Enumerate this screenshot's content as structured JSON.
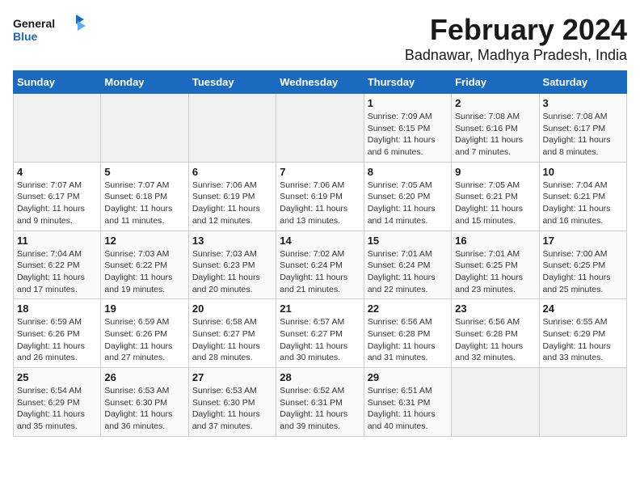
{
  "logo": {
    "line1": "General",
    "line2": "Blue"
  },
  "title": "February 2024",
  "subtitle": "Badnawar, Madhya Pradesh, India",
  "days_of_week": [
    "Sunday",
    "Monday",
    "Tuesday",
    "Wednesday",
    "Thursday",
    "Friday",
    "Saturday"
  ],
  "weeks": [
    [
      {
        "day": "",
        "info": ""
      },
      {
        "day": "",
        "info": ""
      },
      {
        "day": "",
        "info": ""
      },
      {
        "day": "",
        "info": ""
      },
      {
        "day": "1",
        "info": "Sunrise: 7:09 AM\nSunset: 6:15 PM\nDaylight: 11 hours\nand 6 minutes."
      },
      {
        "day": "2",
        "info": "Sunrise: 7:08 AM\nSunset: 6:16 PM\nDaylight: 11 hours\nand 7 minutes."
      },
      {
        "day": "3",
        "info": "Sunrise: 7:08 AM\nSunset: 6:17 PM\nDaylight: 11 hours\nand 8 minutes."
      }
    ],
    [
      {
        "day": "4",
        "info": "Sunrise: 7:07 AM\nSunset: 6:17 PM\nDaylight: 11 hours\nand 9 minutes."
      },
      {
        "day": "5",
        "info": "Sunrise: 7:07 AM\nSunset: 6:18 PM\nDaylight: 11 hours\nand 11 minutes."
      },
      {
        "day": "6",
        "info": "Sunrise: 7:06 AM\nSunset: 6:19 PM\nDaylight: 11 hours\nand 12 minutes."
      },
      {
        "day": "7",
        "info": "Sunrise: 7:06 AM\nSunset: 6:19 PM\nDaylight: 11 hours\nand 13 minutes."
      },
      {
        "day": "8",
        "info": "Sunrise: 7:05 AM\nSunset: 6:20 PM\nDaylight: 11 hours\nand 14 minutes."
      },
      {
        "day": "9",
        "info": "Sunrise: 7:05 AM\nSunset: 6:21 PM\nDaylight: 11 hours\nand 15 minutes."
      },
      {
        "day": "10",
        "info": "Sunrise: 7:04 AM\nSunset: 6:21 PM\nDaylight: 11 hours\nand 16 minutes."
      }
    ],
    [
      {
        "day": "11",
        "info": "Sunrise: 7:04 AM\nSunset: 6:22 PM\nDaylight: 11 hours\nand 17 minutes."
      },
      {
        "day": "12",
        "info": "Sunrise: 7:03 AM\nSunset: 6:22 PM\nDaylight: 11 hours\nand 19 minutes."
      },
      {
        "day": "13",
        "info": "Sunrise: 7:03 AM\nSunset: 6:23 PM\nDaylight: 11 hours\nand 20 minutes."
      },
      {
        "day": "14",
        "info": "Sunrise: 7:02 AM\nSunset: 6:24 PM\nDaylight: 11 hours\nand 21 minutes."
      },
      {
        "day": "15",
        "info": "Sunrise: 7:01 AM\nSunset: 6:24 PM\nDaylight: 11 hours\nand 22 minutes."
      },
      {
        "day": "16",
        "info": "Sunrise: 7:01 AM\nSunset: 6:25 PM\nDaylight: 11 hours\nand 23 minutes."
      },
      {
        "day": "17",
        "info": "Sunrise: 7:00 AM\nSunset: 6:25 PM\nDaylight: 11 hours\nand 25 minutes."
      }
    ],
    [
      {
        "day": "18",
        "info": "Sunrise: 6:59 AM\nSunset: 6:26 PM\nDaylight: 11 hours\nand 26 minutes."
      },
      {
        "day": "19",
        "info": "Sunrise: 6:59 AM\nSunset: 6:26 PM\nDaylight: 11 hours\nand 27 minutes."
      },
      {
        "day": "20",
        "info": "Sunrise: 6:58 AM\nSunset: 6:27 PM\nDaylight: 11 hours\nand 28 minutes."
      },
      {
        "day": "21",
        "info": "Sunrise: 6:57 AM\nSunset: 6:27 PM\nDaylight: 11 hours\nand 30 minutes."
      },
      {
        "day": "22",
        "info": "Sunrise: 6:56 AM\nSunset: 6:28 PM\nDaylight: 11 hours\nand 31 minutes."
      },
      {
        "day": "23",
        "info": "Sunrise: 6:56 AM\nSunset: 6:28 PM\nDaylight: 11 hours\nand 32 minutes."
      },
      {
        "day": "24",
        "info": "Sunrise: 6:55 AM\nSunset: 6:29 PM\nDaylight: 11 hours\nand 33 minutes."
      }
    ],
    [
      {
        "day": "25",
        "info": "Sunrise: 6:54 AM\nSunset: 6:29 PM\nDaylight: 11 hours\nand 35 minutes."
      },
      {
        "day": "26",
        "info": "Sunrise: 6:53 AM\nSunset: 6:30 PM\nDaylight: 11 hours\nand 36 minutes."
      },
      {
        "day": "27",
        "info": "Sunrise: 6:53 AM\nSunset: 6:30 PM\nDaylight: 11 hours\nand 37 minutes."
      },
      {
        "day": "28",
        "info": "Sunrise: 6:52 AM\nSunset: 6:31 PM\nDaylight: 11 hours\nand 39 minutes."
      },
      {
        "day": "29",
        "info": "Sunrise: 6:51 AM\nSunset: 6:31 PM\nDaylight: 11 hours\nand 40 minutes."
      },
      {
        "day": "",
        "info": ""
      },
      {
        "day": "",
        "info": ""
      }
    ]
  ]
}
